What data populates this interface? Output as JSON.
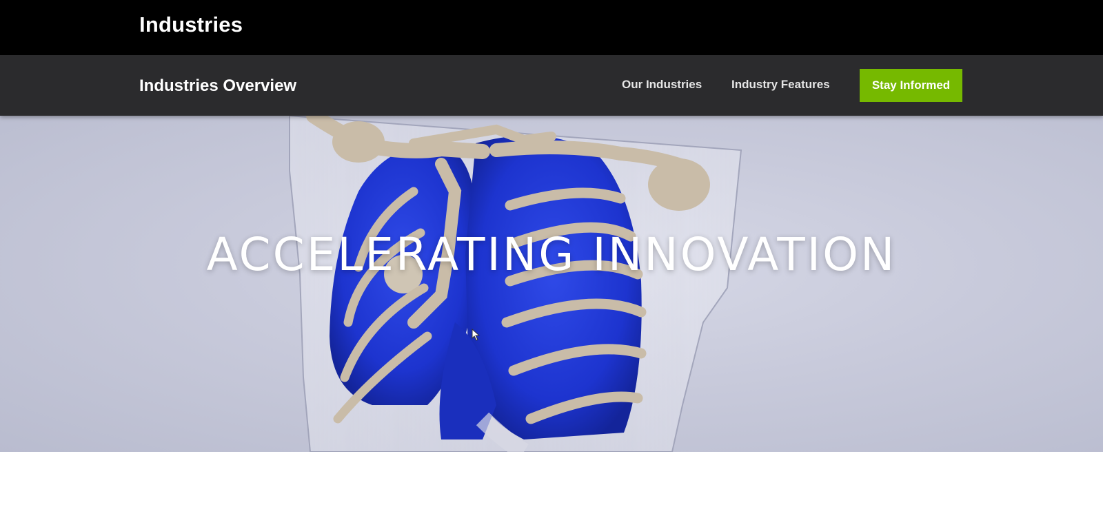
{
  "header": {
    "brand": "Industries"
  },
  "subnav": {
    "title": "Industries Overview",
    "links": [
      {
        "label": "Our Industries"
      },
      {
        "label": "Industry Features"
      }
    ],
    "cta_label": "Stay Informed"
  },
  "hero": {
    "headline": "ACCELERATING INNOVATION",
    "image_subject": "3d-medical-rendering-ribcage-lungs"
  },
  "colors": {
    "topbar": "#000000",
    "subnav": "#2b2b2d",
    "accent": "#76b900",
    "lung_blue": "#1f37d6",
    "bone": "#c9bca8"
  }
}
